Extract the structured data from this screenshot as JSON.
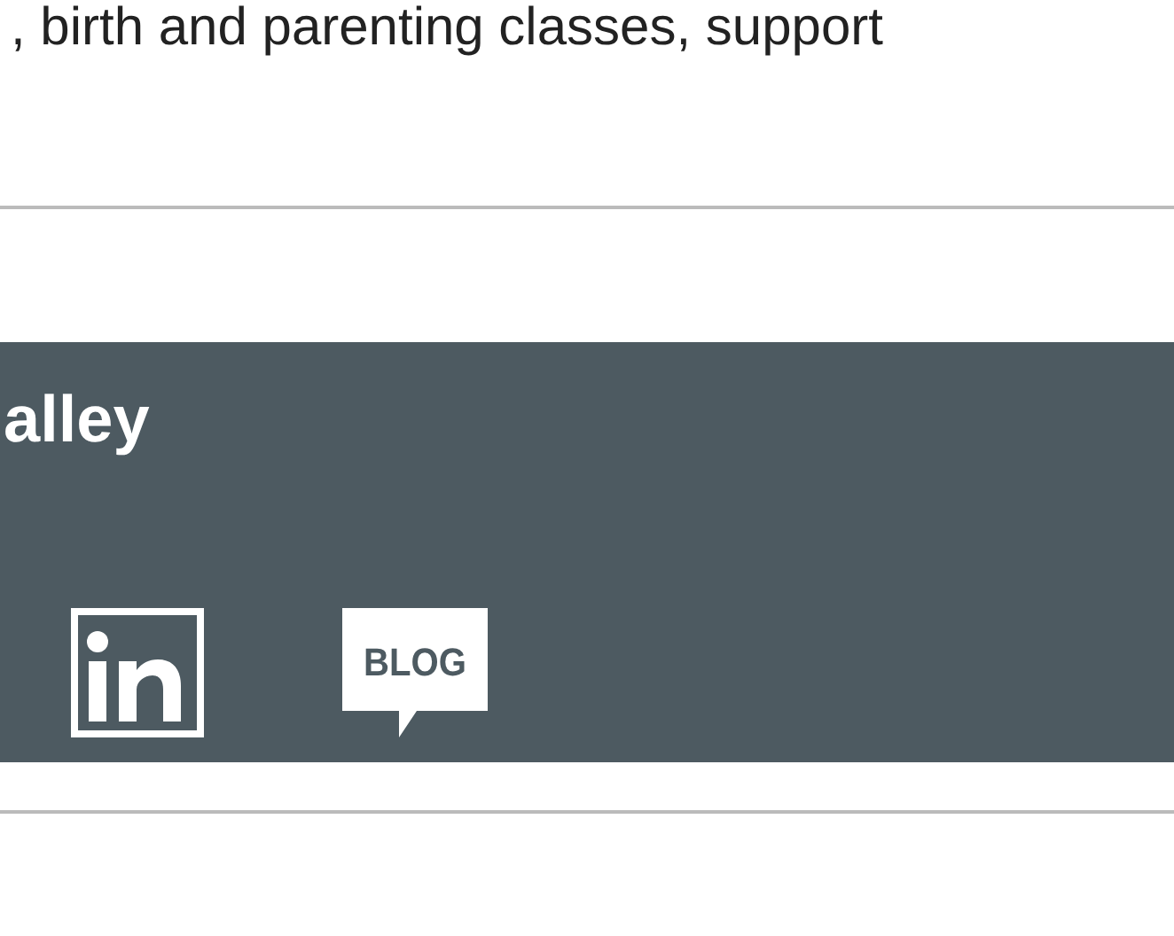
{
  "intro_text": ", birth and parenting classes, support",
  "footer_band": {
    "heading": "alley",
    "blog_label": "BLOG"
  }
}
